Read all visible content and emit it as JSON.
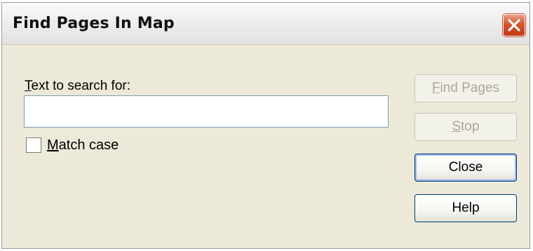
{
  "window": {
    "title": "Find Pages In Map"
  },
  "search": {
    "label_accel": "T",
    "label_rest": "ext to search for:",
    "value": "",
    "placeholder": ""
  },
  "match_case": {
    "label_accel": "M",
    "label_rest": "atch case",
    "checked": false
  },
  "buttons": {
    "find_pages_accel": "F",
    "find_pages_rest": "ind Pages",
    "find_pages_enabled": false,
    "stop_accel": "S",
    "stop_rest": "top",
    "stop_enabled": false,
    "close": "Close",
    "help": "Help"
  },
  "icons": {
    "window_close": "close-x-icon"
  },
  "colors": {
    "dialog_bg": "#ece9d8",
    "close_button": "#d6552f",
    "button_border": "#003c74",
    "disabled_text": "#aca899"
  }
}
